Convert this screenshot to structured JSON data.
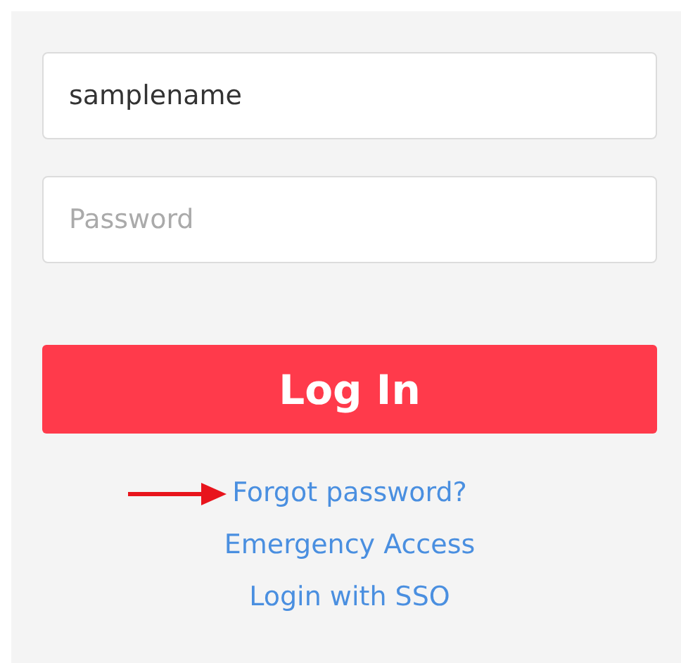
{
  "username_field": {
    "value": "samplename"
  },
  "password_field": {
    "placeholder": "Password"
  },
  "login_button": {
    "label": "Log In"
  },
  "links": [
    {
      "label": "Forgot password?",
      "highlighted": true
    },
    {
      "label": "Emergency Access",
      "highlighted": false
    },
    {
      "label": "Login with SSO",
      "highlighted": false
    }
  ]
}
